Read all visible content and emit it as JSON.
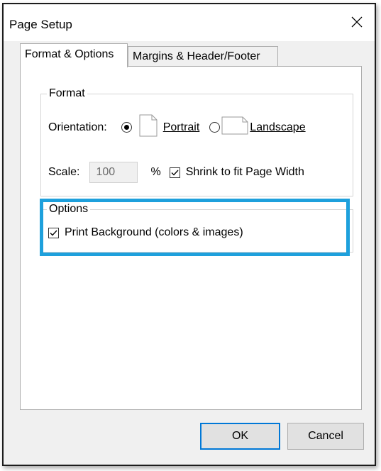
{
  "window": {
    "title": "Page Setup",
    "close_icon": "close-icon"
  },
  "tabs": [
    {
      "label": "Format & Options",
      "active": true
    },
    {
      "label": "Margins & Header/Footer",
      "active": false
    }
  ],
  "format": {
    "group_label": "Format",
    "orientation_label": "Orientation:",
    "portrait": {
      "label": "Portrait",
      "selected": true
    },
    "landscape": {
      "label": "Landscape",
      "selected": false
    },
    "scale_label": "Scale:",
    "scale_value": "100",
    "percent_sign": "%",
    "shrink_to_fit": {
      "label": "Shrink to fit Page Width",
      "checked": true
    }
  },
  "options": {
    "group_label": "Options",
    "print_background": {
      "label": "Print Background (colors & images)",
      "checked": true
    }
  },
  "buttons": {
    "ok": "OK",
    "cancel": "Cancel"
  },
  "colors": {
    "highlight": "#1ea0dc",
    "ok_border": "#0078d7",
    "window_bg": "#f0f0f0"
  }
}
